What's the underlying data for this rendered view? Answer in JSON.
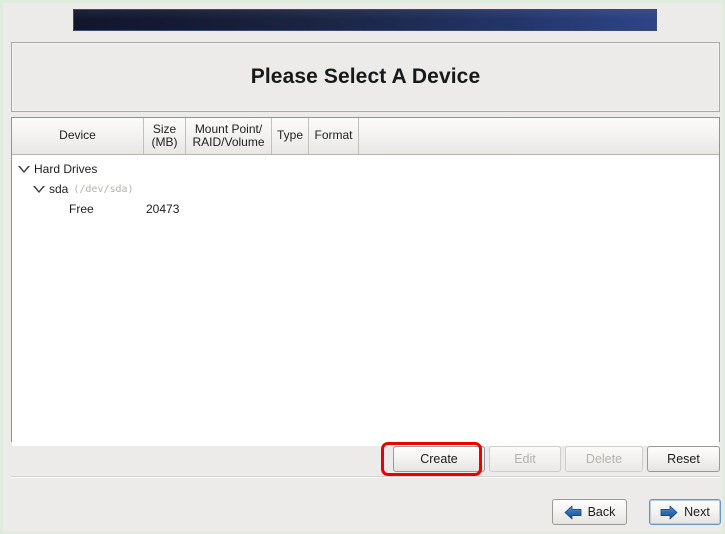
{
  "window": {
    "title": "Please Select A Device",
    "frame_color": "#dfeddf",
    "background": "#ecebe9"
  },
  "banner": {
    "name": "installer-banner",
    "gradient_from": "#11162c",
    "gradient_to": "#2e4486"
  },
  "table": {
    "columns": [
      {
        "id": "device",
        "line1": "Device",
        "line2": ""
      },
      {
        "id": "size",
        "line1": "Size",
        "line2": "(MB)"
      },
      {
        "id": "mount",
        "line1": "Mount Point/",
        "line2": "RAID/Volume"
      },
      {
        "id": "type",
        "line1": "Type",
        "line2": ""
      },
      {
        "id": "format",
        "line1": "Format",
        "line2": ""
      }
    ],
    "rows": [
      {
        "id": "hard-drives",
        "level": 1,
        "expander": "expanded",
        "label": "Hard Drives",
        "path": "",
        "size": "",
        "mount": "",
        "type": "",
        "format": ""
      },
      {
        "id": "sda",
        "level": 2,
        "expander": "expanded",
        "label": "sda",
        "path": "(/dev/sda)",
        "size": "",
        "mount": "",
        "type": "",
        "format": ""
      },
      {
        "id": "free",
        "level": 3,
        "expander": "none",
        "label": "Free",
        "path": "",
        "size": "20473",
        "mount": "",
        "type": "",
        "format": ""
      }
    ]
  },
  "actions": {
    "create": {
      "label": "Create",
      "enabled": true,
      "highlighted": true,
      "highlight_color": "#ee0000"
    },
    "edit": {
      "label": "Edit",
      "enabled": false
    },
    "delete": {
      "label": "Delete",
      "enabled": false
    },
    "reset": {
      "label": "Reset",
      "enabled": true
    }
  },
  "navigation": {
    "back": {
      "label": "Back",
      "icon": "arrow-left-icon",
      "icon_color": "#2f6bb5"
    },
    "next": {
      "label": "Next",
      "icon": "arrow-right-icon",
      "icon_color": "#2f6bb5",
      "focused": true
    }
  }
}
